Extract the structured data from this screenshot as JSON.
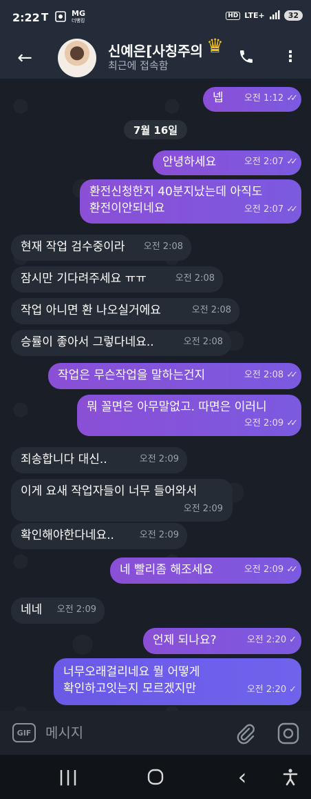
{
  "status_bar": {
    "time": "2:22",
    "mg_top": "MG",
    "mg_bottom": "더뱅킹",
    "hd": "HD",
    "network": "LTE+",
    "battery": "32"
  },
  "header": {
    "contact_name": "신예은[사칭주의",
    "crown_glyph": "♛",
    "last_seen": "최근에 접속함",
    "back_glyph": "←",
    "menu_glyph": "⋮"
  },
  "date_separator": "7월 16일",
  "messages": [
    {
      "dir": "out",
      "text": "넵",
      "time": "오전 1:12",
      "status": "✓✓"
    },
    {
      "dir": "out",
      "text": "안녕하세요",
      "time": "오전 2:07",
      "status": "✓✓"
    },
    {
      "dir": "out",
      "text_line1": "환전신청한지 40분지났는데 아직도",
      "text_line2": "환전이안되네요",
      "time": "오전 2:07",
      "status": "✓✓"
    },
    {
      "dir": "in",
      "text": "현재 작업 검수중이라",
      "time": "오전 2:08"
    },
    {
      "dir": "in",
      "text": "잠시만 기다려주세요 ㅠㅠ",
      "time": "오전 2:08"
    },
    {
      "dir": "in",
      "text": "작업 아니면 환 나오실거에요",
      "time": "오전 2:08"
    },
    {
      "dir": "in",
      "text": "승률이 좋아서 그렇다네요..",
      "time": "오전 2:08"
    },
    {
      "dir": "out",
      "text": "작업은 무슨작업을 말하는건지",
      "time": "오전 2:08",
      "status": "✓✓"
    },
    {
      "dir": "out",
      "text": "뭐 꼴면은 아무말없고. 따면은 이러니",
      "time": "오전 2:09",
      "status": "✓✓"
    },
    {
      "dir": "in",
      "text": "죄송합니다 대신..",
      "time": "오전 2:09"
    },
    {
      "dir": "in",
      "text": "이게 요새 작업자들이 너무 들어와서",
      "time": "오전 2:09"
    },
    {
      "dir": "in",
      "text": "확인해야한다네요..",
      "time": "오전 2:09"
    },
    {
      "dir": "out",
      "text": "네 빨리좀 해조세요",
      "time": "오전 2:09",
      "status": "✓✓"
    },
    {
      "dir": "in",
      "text": "네네",
      "time": "오전 2:09"
    },
    {
      "dir": "out",
      "text": "언제 되나요?",
      "time": "오전 2:20",
      "status": "✓"
    },
    {
      "dir": "out",
      "text_line1": "너무오래걸리네요 뭘 어떻게",
      "text_line2": "확인하고잇는지 모르겠지만",
      "time": "오전 2:20",
      "status": "✓"
    }
  ],
  "input_bar": {
    "gif_label": "GIF",
    "placeholder": "메시지"
  },
  "nav_bar": {
    "recents_glyph": "|||",
    "back_glyph": "‹"
  },
  "colors": {
    "outgoing_bubble": "#8a4fd6",
    "incoming_bubble": "#262c35",
    "header": "#232c38",
    "crown": "#f0c419"
  }
}
